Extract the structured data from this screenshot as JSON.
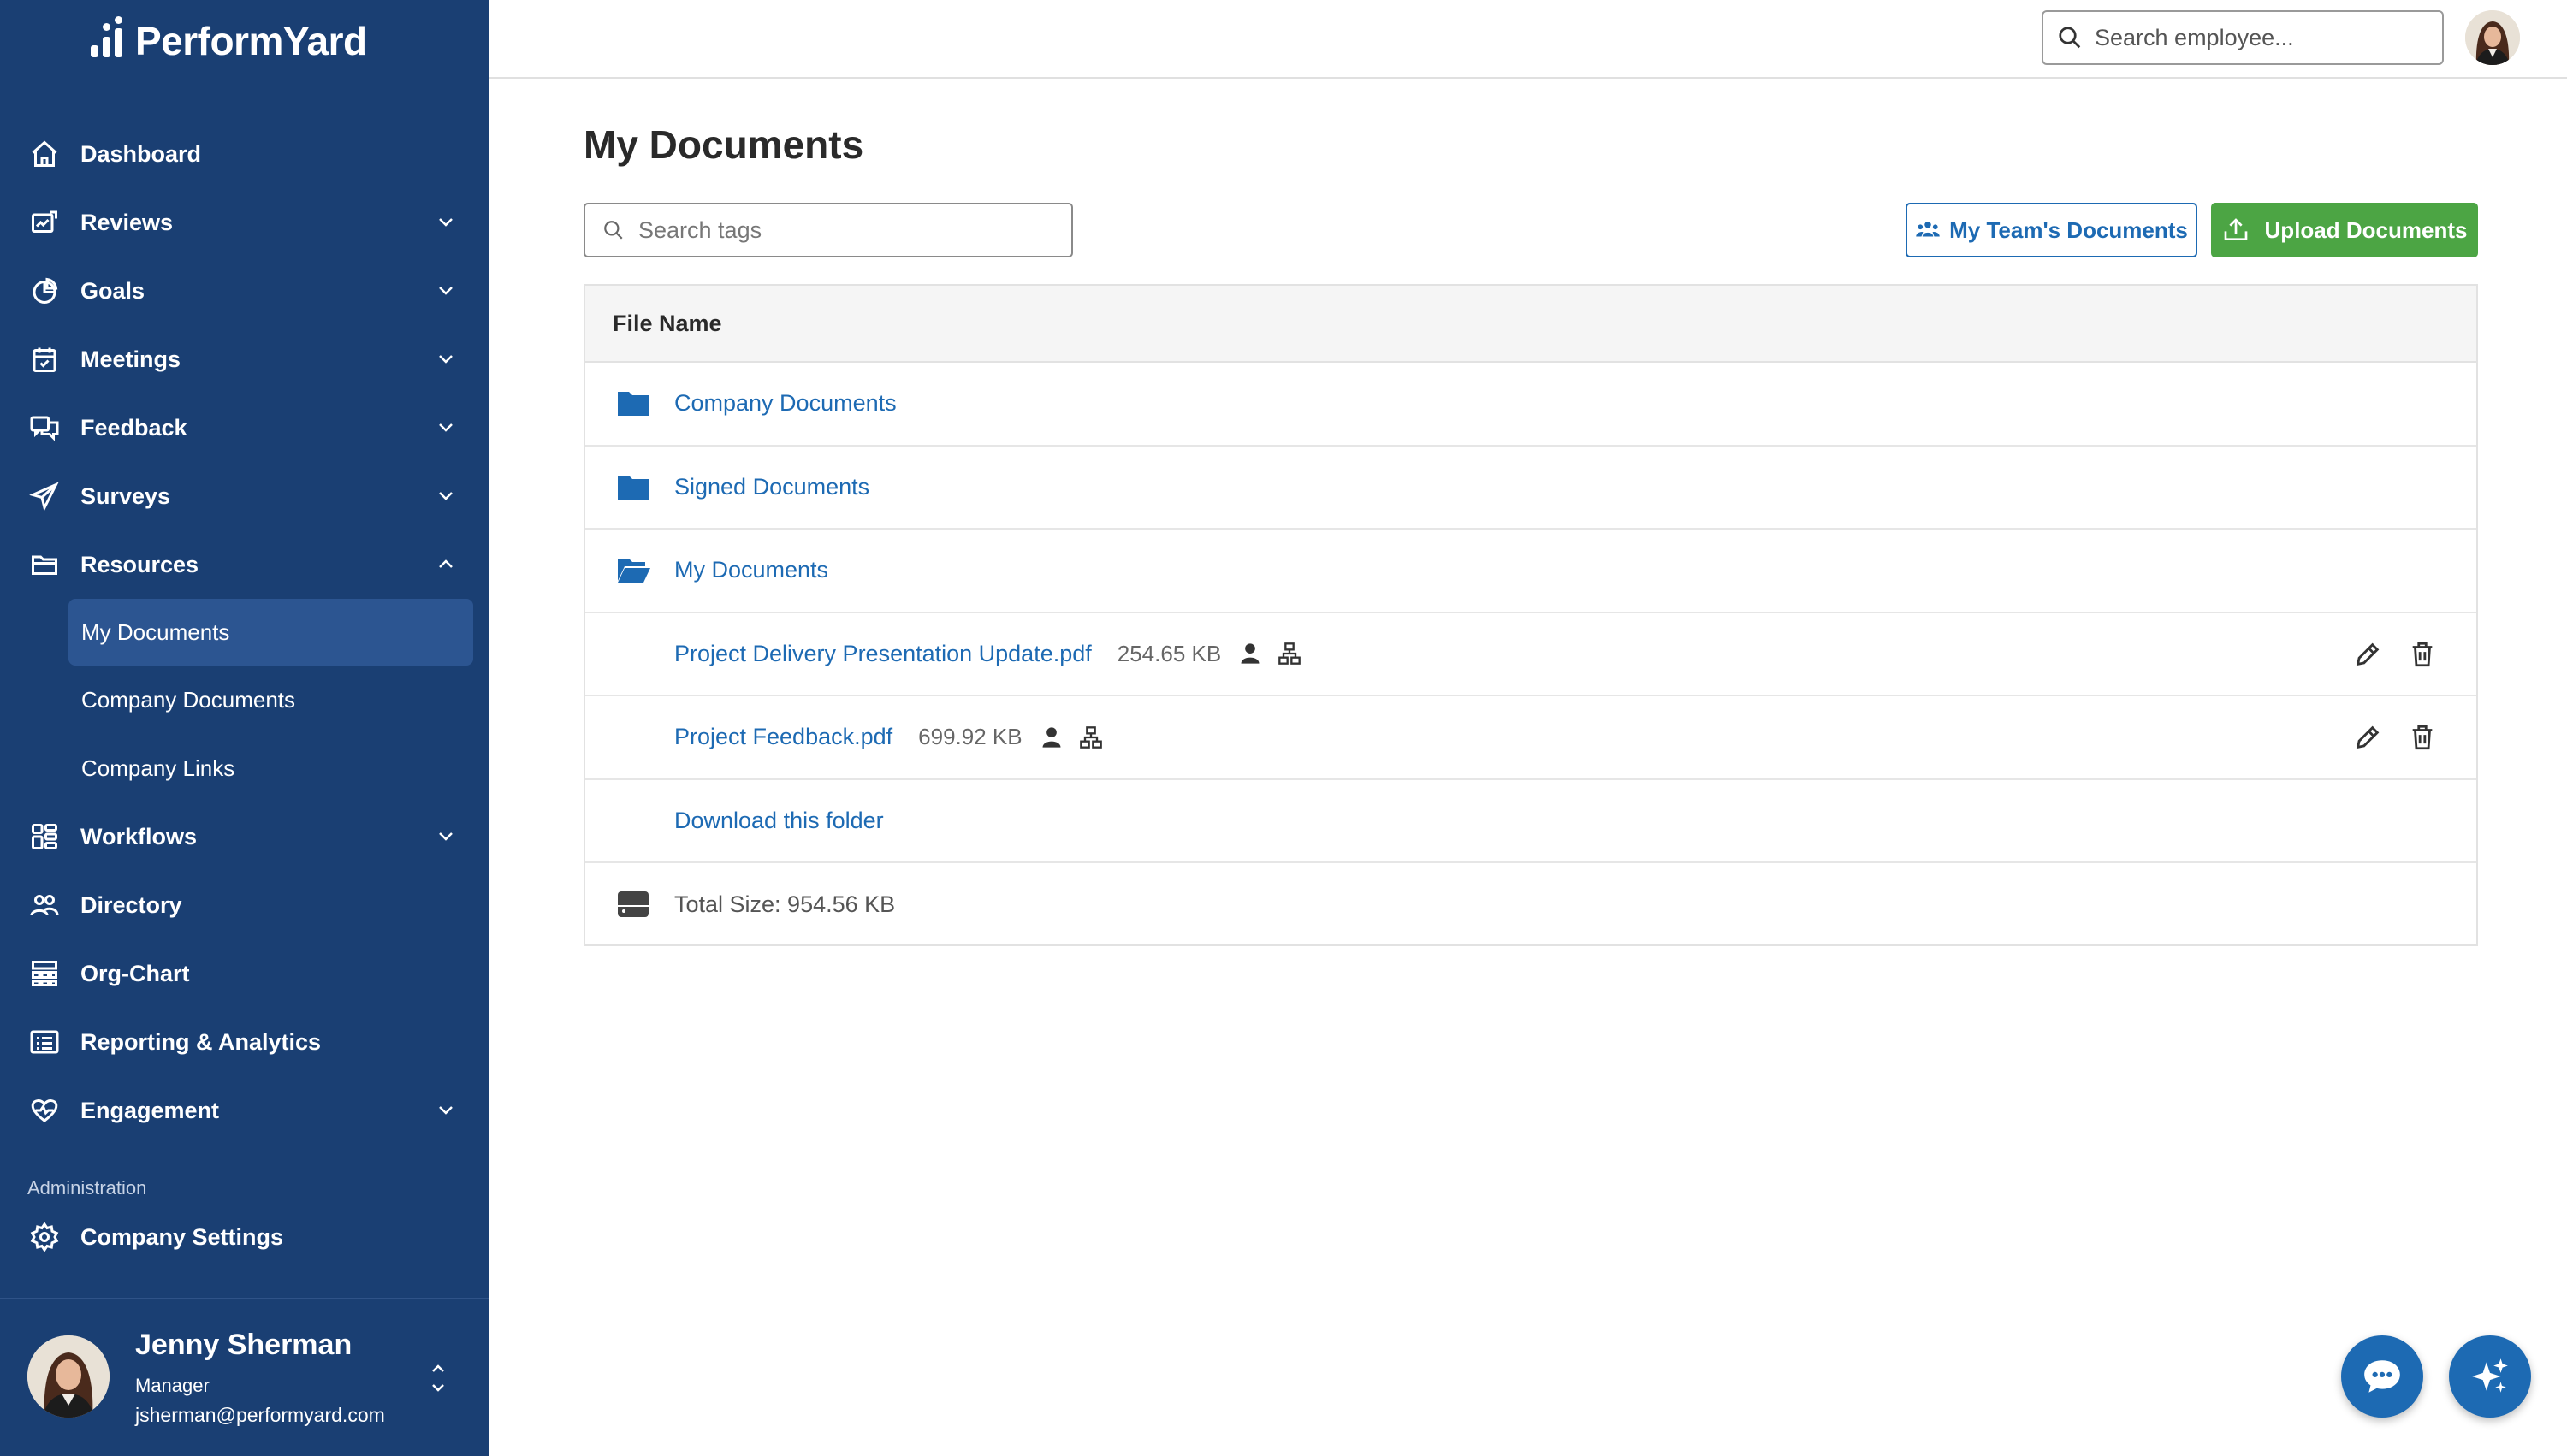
{
  "app": {
    "brand": "PerformYard"
  },
  "sidebar": {
    "items": [
      {
        "label": "Dashboard",
        "icon": "home-icon",
        "chevron": ""
      },
      {
        "label": "Reviews",
        "icon": "reviews-icon",
        "chevron": "down"
      },
      {
        "label": "Goals",
        "icon": "goals-icon",
        "chevron": "down"
      },
      {
        "label": "Meetings",
        "icon": "calendar-icon",
        "chevron": "down"
      },
      {
        "label": "Feedback",
        "icon": "chat-bubbles-icon",
        "chevron": "down"
      },
      {
        "label": "Surveys",
        "icon": "paper-plane-icon",
        "chevron": "down"
      },
      {
        "label": "Resources",
        "icon": "folder-icon",
        "chevron": "up"
      }
    ],
    "resources_sub": [
      {
        "label": "My Documents",
        "active": true
      },
      {
        "label": "Company Documents",
        "active": false
      },
      {
        "label": "Company Links",
        "active": false
      }
    ],
    "items_after": [
      {
        "label": "Workflows",
        "icon": "workflows-icon",
        "chevron": "down"
      },
      {
        "label": "Directory",
        "icon": "people-icon",
        "chevron": ""
      },
      {
        "label": "Org-Chart",
        "icon": "org-chart-icon",
        "chevron": ""
      },
      {
        "label": "Reporting & Analytics",
        "icon": "report-icon",
        "chevron": ""
      },
      {
        "label": "Engagement",
        "icon": "heart-pulse-icon",
        "chevron": "down"
      }
    ],
    "admin_section": "Administration",
    "admin_item": "Company Settings",
    "user": {
      "name": "Jenny Sherman",
      "role": "Manager",
      "email": "jsherman@performyard.com"
    }
  },
  "topbar": {
    "employee_search_placeholder": "Search employee..."
  },
  "main": {
    "title": "My Documents",
    "tag_search_placeholder": "Search tags",
    "team_docs_button": "My Team's Documents",
    "upload_button": "Upload Documents",
    "table": {
      "header": "File Name",
      "folders": [
        {
          "name": "Company Documents",
          "open": false
        },
        {
          "name": "Signed Documents",
          "open": false
        },
        {
          "name": "My Documents",
          "open": true
        }
      ],
      "files": [
        {
          "name": "Project Delivery Presentation Update.pdf",
          "size": "254.65 KB"
        },
        {
          "name": "Project Feedback.pdf",
          "size": "699.92 KB"
        }
      ],
      "download_link": "Download this folder",
      "total_size": "Total Size: 954.56 KB"
    }
  },
  "colors": {
    "sidebar_bg": "#1a3f73",
    "sidebar_active": "#2c5591",
    "link_blue": "#1d6ab3",
    "upload_green": "#4ca544"
  }
}
